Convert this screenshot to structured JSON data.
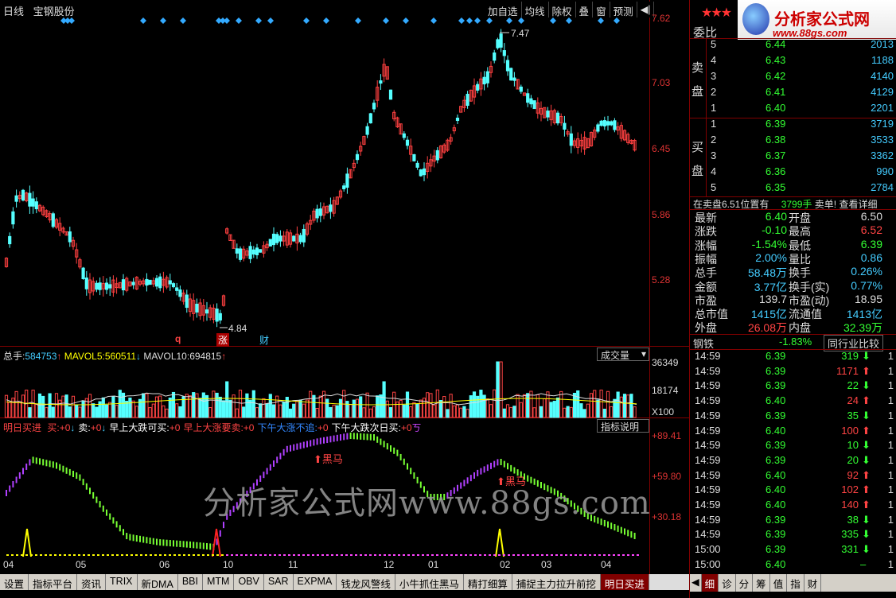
{
  "header": {
    "period": "日线",
    "stock_name": "宝钢股份"
  },
  "toolbar": [
    "加自选",
    "均线",
    "除权",
    "叠",
    "窗",
    "预测",
    "◀|"
  ],
  "price_axis": [
    "7.62",
    "7.03",
    "6.45",
    "5.86",
    "5.28"
  ],
  "annotations": {
    "high": "7.47",
    "low": "4.84",
    "q": "q",
    "zhang": "涨",
    "cai": "财"
  },
  "volume": {
    "line_prefix": "总手:",
    "total": "584753",
    "total_arrow": "↑",
    "ma5_label": "MAVOL5:",
    "ma5": "560511",
    "ma5_arrow": "↓",
    "ma10_label": "MAVOL10:",
    "ma10": "694815",
    "ma10_arrow": "↑",
    "tab_label": "成交量",
    "axis": [
      "36349",
      "18174",
      "X100"
    ]
  },
  "indicator": {
    "name": "明日买进",
    "items": [
      {
        "label": "买:",
        "value": "+0",
        "arrow": "↓"
      },
      {
        "label": "卖:",
        "value": "+0",
        "arrow": "↓"
      },
      {
        "label": "早上大跌可买:",
        "value": "+0",
        "arrow": ""
      },
      {
        "label": "早上大涨要卖:",
        "value": "+0",
        "arrow": ""
      },
      {
        "label": "下午大涨不追:",
        "value": "+0",
        "arrow": ""
      },
      {
        "label": "下午大跌次日买:",
        "value": "+0",
        "arrow": "ㄎ"
      }
    ],
    "tab_label": "指标说明",
    "axis": [
      "+89.41",
      "+59.80",
      "+30.18"
    ],
    "marker_text": "黑马"
  },
  "watermark": "分析家公式网www.88gs.com",
  "time_axis": [
    "04",
    "05",
    "06",
    "10",
    "11",
    "12",
    "01",
    "02",
    "03",
    "04"
  ],
  "bottom_tabs": [
    "设置",
    "指标平台",
    "资讯",
    "TRIX",
    "新DMA",
    "BBI",
    "MTM",
    "OBV",
    "SAR",
    "EXPMA",
    "钱龙风警线",
    "小牛抓住黑马",
    "精打细算",
    "捕捉主力拉升前挖",
    "明日买进"
  ],
  "logo": {
    "title": "分析家公式网",
    "url": "www.88gs.com"
  },
  "order_book": {
    "title": "委比",
    "sell_label": [
      "卖",
      "盘"
    ],
    "buy_label": [
      "买",
      "盘"
    ],
    "sell": [
      {
        "level": "5",
        "price": "6.44",
        "vol": "2013"
      },
      {
        "level": "4",
        "price": "6.43",
        "vol": "1188"
      },
      {
        "level": "3",
        "price": "6.42",
        "vol": "4140"
      },
      {
        "level": "2",
        "price": "6.41",
        "vol": "4129"
      },
      {
        "level": "1",
        "price": "6.40",
        "vol": "2201"
      }
    ],
    "buy": [
      {
        "level": "1",
        "price": "6.39",
        "vol": "3719"
      },
      {
        "level": "2",
        "price": "6.38",
        "vol": "3533"
      },
      {
        "level": "3",
        "price": "6.37",
        "vol": "3362"
      },
      {
        "level": "4",
        "price": "6.36",
        "vol": "990"
      },
      {
        "level": "5",
        "price": "6.35",
        "vol": "2784"
      }
    ],
    "notice": {
      "text": "在卖盘6.51位置有",
      "qty": "3799手",
      "suffix": "卖单!",
      "link": "查看详细"
    }
  },
  "quote": [
    {
      "l": "最新",
      "v": "6.40",
      "vc": "green",
      "l2": "开盘",
      "v2": "6.50",
      "v2c": "white"
    },
    {
      "l": "涨跌",
      "v": "-0.10",
      "vc": "green",
      "l2": "最高",
      "v2": "6.52",
      "v2c": "red"
    },
    {
      "l": "涨幅",
      "v": "-1.54%",
      "vc": "green",
      "l2": "最低",
      "v2": "6.39",
      "v2c": "green"
    },
    {
      "l": "振幅",
      "v": "2.00%",
      "vc": "cyan",
      "l2": "量比",
      "v2": "0.86",
      "v2c": "cyan"
    },
    {
      "l": "总手",
      "v": "58.48万",
      "vc": "cyan",
      "l2": "换手",
      "v2": "0.26%",
      "v2c": "cyan"
    },
    {
      "l": "金额",
      "v": "3.77亿",
      "vc": "cyan",
      "l2": "换手(实)",
      "v2": "0.77%",
      "v2c": "cyan"
    },
    {
      "l": "市盈",
      "v": "139.7",
      "vc": "white",
      "l2": "市盈(动)",
      "v2": "18.95",
      "v2c": "white"
    },
    {
      "l": "总市值",
      "v": "1415亿",
      "vc": "cyan",
      "l2": "流通值",
      "v2": "1413亿",
      "v2c": "cyan"
    },
    {
      "l": "外盘",
      "v": "26.08万",
      "vc": "red",
      "l2": "内盘",
      "v2": "32.39万",
      "v2c": "green"
    }
  ],
  "sector": {
    "name": "钢铁",
    "change": "-1.83%",
    "button": "同行业比较"
  },
  "ticks": [
    {
      "t": "14:59",
      "p": "6.39",
      "v": "319",
      "d": "down"
    },
    {
      "t": "14:59",
      "p": "6.39",
      "v": "1171",
      "d": "up"
    },
    {
      "t": "14:59",
      "p": "6.39",
      "v": "22",
      "d": "down"
    },
    {
      "t": "14:59",
      "p": "6.40",
      "v": "24",
      "d": "up"
    },
    {
      "t": "14:59",
      "p": "6.39",
      "v": "35",
      "d": "down"
    },
    {
      "t": "14:59",
      "p": "6.40",
      "v": "100",
      "d": "up"
    },
    {
      "t": "14:59",
      "p": "6.39",
      "v": "10",
      "d": "down"
    },
    {
      "t": "14:59",
      "p": "6.39",
      "v": "20",
      "d": "down"
    },
    {
      "t": "14:59",
      "p": "6.40",
      "v": "92",
      "d": "up"
    },
    {
      "t": "14:59",
      "p": "6.40",
      "v": "102",
      "d": "up"
    },
    {
      "t": "14:59",
      "p": "6.40",
      "v": "140",
      "d": "up"
    },
    {
      "t": "14:59",
      "p": "6.39",
      "v": "38",
      "d": "down"
    },
    {
      "t": "14:59",
      "p": "6.39",
      "v": "335",
      "d": "down"
    },
    {
      "t": "15:00",
      "p": "6.39",
      "v": "331",
      "d": "down"
    },
    {
      "t": "15:00",
      "p": "6.40",
      "v": "",
      "d": "none"
    }
  ],
  "tick_count_col": "1",
  "right_tabs": [
    "细",
    "诊",
    "分",
    "筹",
    "值",
    "指",
    "财"
  ]
}
